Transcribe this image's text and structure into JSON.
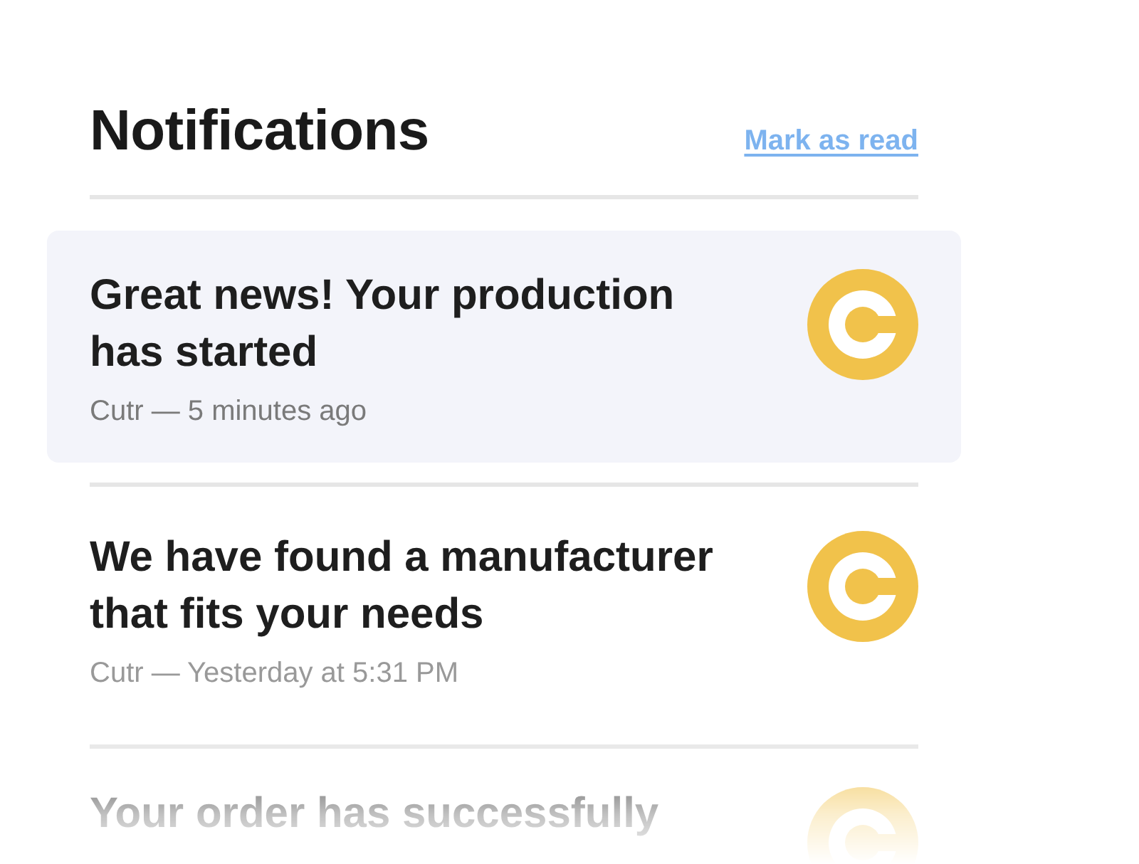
{
  "header": {
    "title": "Notifications",
    "action": "Mark as read"
  },
  "notifications": [
    {
      "title": "Great news! Your production has started",
      "meta": "Cutr — 5 minutes ago",
      "unread": true
    },
    {
      "title": "We have found a manufacturer that fits your needs",
      "meta": "Cutr — Yesterday at 5:31 PM",
      "unread": false
    },
    {
      "title": "Your order has successfully"
    }
  ]
}
